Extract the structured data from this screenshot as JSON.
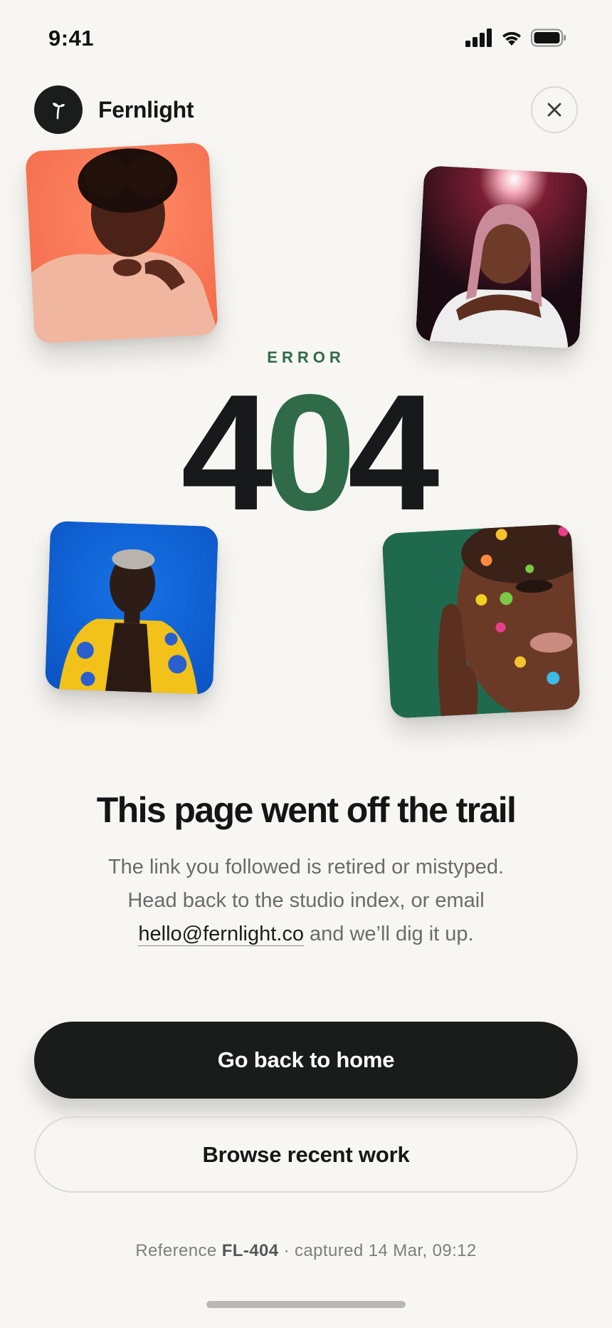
{
  "status_bar": {
    "time": "9:41"
  },
  "header": {
    "brand_name": "Fernlight",
    "logo_icon": "sprout-icon",
    "close_icon": "close-icon"
  },
  "error": {
    "label": "ERROR",
    "code_first": "4",
    "code_middle": "0",
    "code_last": "4"
  },
  "message": {
    "headline": "This page went off the trail",
    "body_line_1": "The link you followed is retired or mistyped.",
    "body_line_2": "Head back to the studio index, or email",
    "email": "hello@fernlight.co",
    "body_line_3_suffix": " and we’ll dig it up."
  },
  "actions": {
    "primary_label": "Go back to home",
    "secondary_label": "Browse recent work"
  },
  "footer": {
    "reference_prefix": "Reference ",
    "reference_code": "FL-404",
    "captured_text": " · captured 14 Mar, 09:12"
  },
  "colors": {
    "background": "#f7f6f2",
    "accent_green": "#2f6b48",
    "ink": "#18191a",
    "muted": "#6a6b6c"
  }
}
